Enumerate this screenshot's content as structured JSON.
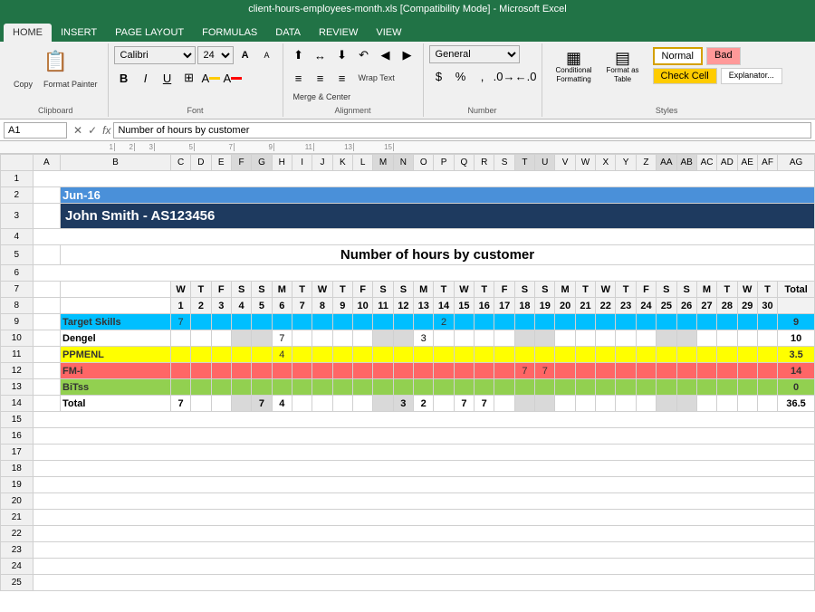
{
  "titleBar": {
    "text": "client-hours-employees-month.xls [Compatibility Mode] - Microsoft Excel"
  },
  "ribbonTabs": [
    "HOME",
    "INSERT",
    "PAGE LAYOUT",
    "FORMULAS",
    "DATA",
    "REVIEW",
    "VIEW"
  ],
  "activeTab": "HOME",
  "ribbon": {
    "clipboard": {
      "label": "Clipboard",
      "paste": "Paste",
      "copy": "Copy",
      "formatPainter": "Format Painter"
    },
    "font": {
      "label": "Font",
      "fontName": "Calibri",
      "fontSize": "24",
      "bold": "B",
      "italic": "I",
      "underline": "U"
    },
    "alignment": {
      "label": "Alignment",
      "wrapText": "Wrap Text",
      "mergeCenter": "Merge & Center"
    },
    "number": {
      "label": "Number",
      "format": "General"
    },
    "styles": {
      "label": "Styles",
      "normal": "Normal",
      "bad": "Bad",
      "checkCell": "Check Cell",
      "explanatory": "Explanator...",
      "conditional": "Conditional Formatting",
      "formatAsTable": "Format as Table"
    }
  },
  "formulaBar": {
    "nameBox": "A1",
    "formula": "Number of hours by customer"
  },
  "spreadsheet": {
    "dateHeader": "Jun-16",
    "nameHeader": "John Smith -  AS123456",
    "tableTitle": "Number of hours by customer",
    "colHeaders": [
      "",
      "W",
      "T",
      "F",
      "S",
      "S",
      "M",
      "T",
      "W",
      "T",
      "F",
      "S",
      "S",
      "M",
      "T",
      "W",
      "T",
      "F",
      "S",
      "S",
      "M",
      "T",
      "W",
      "T",
      "F",
      "S",
      "S",
      "M",
      "T",
      "W",
      "T",
      "Total"
    ],
    "dayNums": [
      "",
      "1",
      "2",
      "3",
      "4",
      "5",
      "6",
      "7",
      "8",
      "9",
      "10",
      "11",
      "12",
      "13",
      "14",
      "15",
      "16",
      "17",
      "18",
      "19",
      "20",
      "21",
      "22",
      "23",
      "24",
      "25",
      "26",
      "27",
      "28",
      "29",
      "30",
      ""
    ],
    "rows": [
      {
        "label": "Target Skills",
        "color": "target",
        "vals": [
          "7",
          "",
          "",
          "",
          "",
          "",
          "",
          "",
          "",
          "",
          "",
          "",
          "",
          "",
          "",
          "2",
          "",
          "",
          "",
          "",
          "",
          "",
          "",
          "",
          "",
          "",
          "",
          "",
          "",
          "",
          "",
          "9"
        ]
      },
      {
        "label": "Dengel",
        "color": "dengel",
        "vals": [
          "",
          "",
          "",
          "",
          "7",
          "",
          "",
          "",
          "",
          "",
          "",
          "",
          "3",
          "",
          "",
          "",
          "",
          "",
          "",
          "",
          "",
          "",
          "",
          "",
          "",
          "",
          "",
          "",
          "",
          "",
          "",
          "10"
        ]
      },
      {
        "label": "PPMENL",
        "color": "ppmenl",
        "vals": [
          "",
          "",
          "",
          "",
          "",
          "4",
          "",
          "",
          "",
          "",
          "",
          "",
          "",
          "",
          "",
          "",
          "",
          "",
          "",
          "",
          "",
          "",
          "",
          "",
          "",
          "",
          "",
          "",
          "",
          "",
          "",
          "3.5"
        ]
      },
      {
        "label": "FM-i",
        "color": "fmi",
        "vals": [
          "",
          "",
          "",
          "",
          "",
          "",
          "",
          "",
          "",
          "",
          "",
          "",
          "",
          "",
          "",
          "",
          "7",
          "7",
          "",
          "",
          "",
          "",
          "",
          "",
          "",
          "",
          "",
          "",
          "",
          "",
          "",
          "14"
        ]
      },
      {
        "label": "BiTss",
        "color": "bitss",
        "vals": [
          "",
          "",
          "",
          "",
          "",
          "",
          "",
          "",
          "",
          "",
          "",
          "",
          "",
          "",
          "",
          "",
          "",
          "",
          "",
          "",
          "",
          "",
          "",
          "",
          "",
          "",
          "",
          "",
          "",
          "",
          "",
          "0"
        ]
      },
      {
        "label": "Total",
        "color": "total",
        "vals": [
          "7",
          "",
          "",
          "",
          "7",
          "4",
          "",
          "",
          "",
          "",
          "",
          "",
          "3",
          "2",
          "",
          "7",
          "7",
          "",
          "",
          "",
          "",
          "",
          "",
          "",
          "",
          "",
          "",
          "",
          "",
          "",
          "",
          "36.5"
        ]
      }
    ],
    "weekendCols": [
      4,
      5,
      11,
      12,
      18,
      19,
      25,
      26
    ]
  }
}
